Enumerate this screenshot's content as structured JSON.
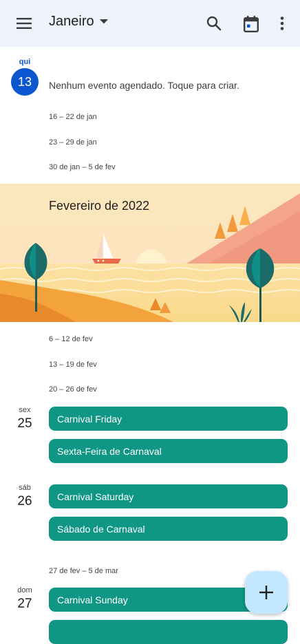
{
  "header": {
    "month": "Janeiro"
  },
  "today": {
    "dow": "qui",
    "day": "13",
    "empty_text": "Nenhum evento agendado. Toque para criar."
  },
  "weeks_before": [
    "16 – 22 de jan",
    "23 – 29 de jan",
    "30 de jan – 5 de fev"
  ],
  "banner": {
    "title": "Fevereiro de 2022"
  },
  "weeks_after": [
    "6 – 12 de fev",
    "13 – 19 de fev",
    "20 – 26 de fev"
  ],
  "days": [
    {
      "dow": "sex",
      "day": "25",
      "events": [
        "Carnival Friday",
        "Sexta-Feira de Carnaval"
      ]
    },
    {
      "dow": "sáb",
      "day": "26",
      "events": [
        "Carnival Saturday",
        "Sábado de Carnaval"
      ]
    },
    {
      "dow": "dom",
      "day": "27",
      "events": [
        "Carnival Sunday",
        ""
      ]
    }
  ],
  "week_last": "27 de fev – 5 de mar",
  "colors": {
    "appbar": "#eef2fb",
    "event": "#0f9684",
    "today": "#0b57d0",
    "fab": "#c2e7ff"
  },
  "icons": {
    "menu": "menu-icon",
    "dropdown": "arrow-drop-down-icon",
    "search": "search-icon",
    "today": "calendar-today-icon",
    "more": "more-vert-icon",
    "add": "add-icon"
  }
}
